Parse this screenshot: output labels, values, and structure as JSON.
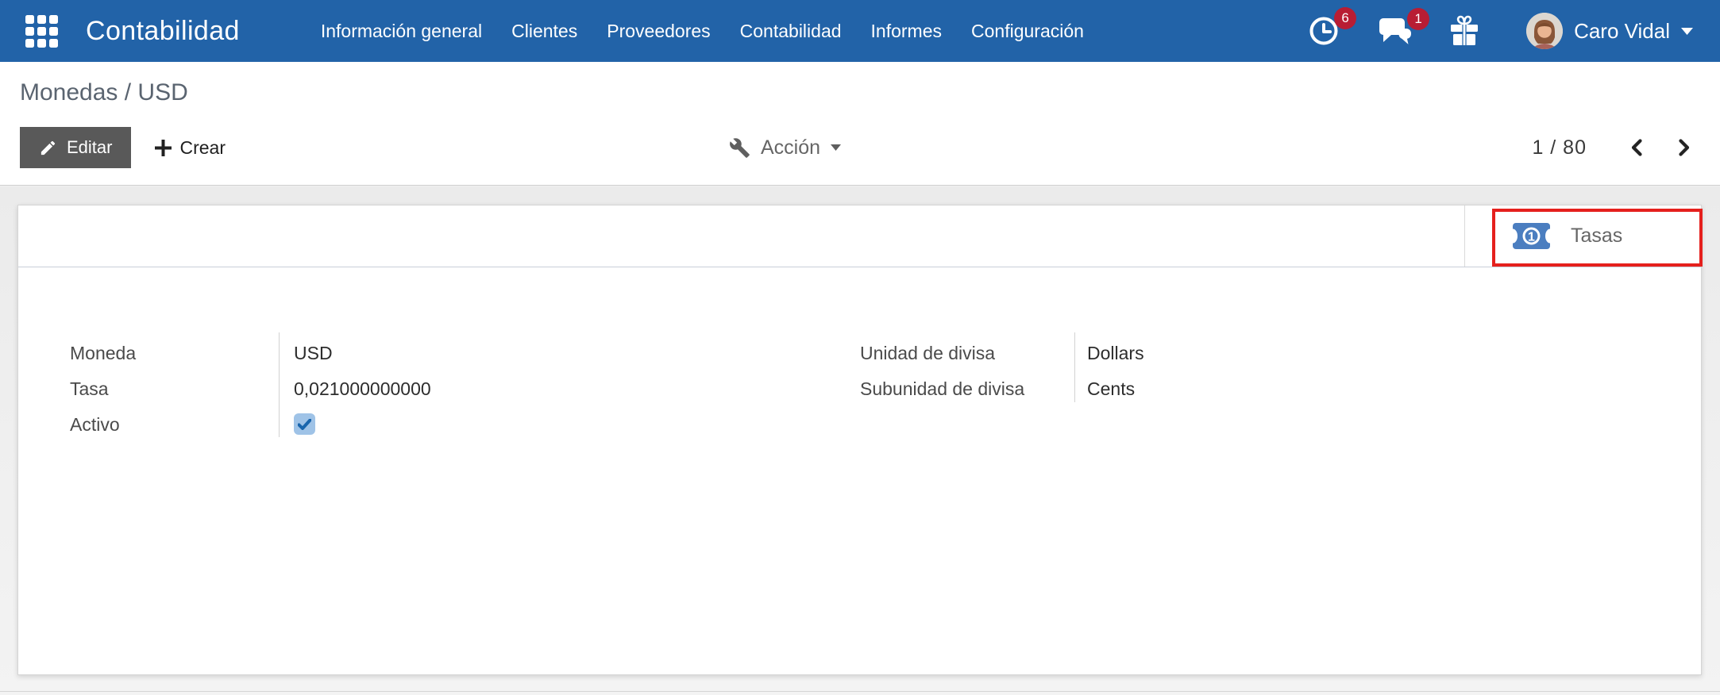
{
  "nav": {
    "brand": "Contabilidad",
    "menu_items": [
      "Información general",
      "Clientes",
      "Proveedores",
      "Contabilidad",
      "Informes",
      "Configuración"
    ],
    "activity_badge": "6",
    "message_badge": "1",
    "user_name": "Caro Vidal"
  },
  "control_panel": {
    "breadcrumb": "Monedas / USD",
    "edit_button": "Editar",
    "create_button": "Crear",
    "action_menu": "Acción",
    "pager": "1 / 80"
  },
  "card": {
    "stat_button": {
      "label": "Tasas",
      "icon": "money-bill-icon",
      "highlighted": true
    },
    "active_checked": "true",
    "left_fields": [
      {
        "label": "Moneda",
        "value": "USD"
      },
      {
        "label": "Tasa",
        "value": "0,021000000000"
      },
      {
        "label": "Activo",
        "value": "",
        "checkbox": true,
        "checked": true
      }
    ],
    "right_fields": [
      {
        "label": "Unidad de divisa",
        "value": "Dollars"
      },
      {
        "label": "Subunidad de divisa",
        "value": "Cents"
      }
    ]
  },
  "icons": [
    "apps-grid-icon",
    "clock-icon",
    "chat-icon",
    "gift-icon",
    "chevron-down-icon",
    "pencil-icon",
    "plus-icon",
    "wrench-icon",
    "chevron-left-icon",
    "chevron-right-icon",
    "money-bill-icon",
    "checkmark-icon"
  ],
  "colors": {
    "navbar": "#2263a8",
    "badge": "#b81d34",
    "edit_button_bg": "#595959",
    "highlight": "#e5201d",
    "stat_icon_blue": "#4b7ec0",
    "checkbox_bg": "#9fc3e7",
    "checkbox_check": "#1a66ad"
  }
}
